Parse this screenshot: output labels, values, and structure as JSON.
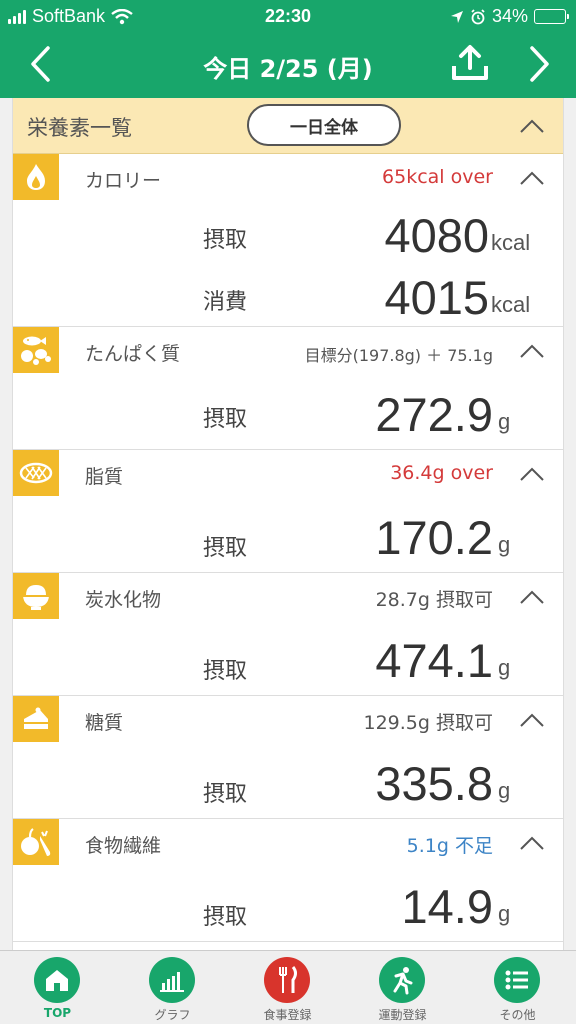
{
  "status_bar": {
    "carrier": "SoftBank",
    "time": "22:30",
    "battery": "34%",
    "battery_level": 0.34
  },
  "header": {
    "title": "今日 2/25 (月)"
  },
  "summary": {
    "label": "栄養素一覧",
    "button": "一日全体"
  },
  "sections": [
    {
      "name": "カロリー",
      "status": "65kcal over",
      "rows": [
        {
          "label": "摂取",
          "value": "4080",
          "unit": "kcal"
        },
        {
          "label": "消費",
          "value": "4015",
          "unit": "kcal"
        }
      ]
    },
    {
      "name": "たんぱく質",
      "status": "目標分(197.8g) ＋ 75.1g",
      "rows": [
        {
          "label": "摂取",
          "value": "272.9",
          "unit": "g"
        }
      ]
    },
    {
      "name": "脂質",
      "status": "36.4g over",
      "rows": [
        {
          "label": "摂取",
          "value": "170.2",
          "unit": "g"
        }
      ]
    },
    {
      "name": "炭水化物",
      "status": "28.7g 摂取可",
      "rows": [
        {
          "label": "摂取",
          "value": "474.1",
          "unit": "g"
        }
      ]
    },
    {
      "name": "糖質",
      "status": "129.5g 摂取可",
      "rows": [
        {
          "label": "摂取",
          "value": "335.8",
          "unit": "g"
        }
      ]
    },
    {
      "name": "食物繊維",
      "status": "5.1g 不足",
      "rows": [
        {
          "label": "摂取",
          "value": "14.9",
          "unit": "g"
        }
      ]
    }
  ],
  "tabs": [
    {
      "label": "TOP",
      "icon": "home-icon"
    },
    {
      "label": "グラフ",
      "icon": "bar-chart-icon"
    },
    {
      "label": "食事登録",
      "icon": "fork-knife-icon"
    },
    {
      "label": "運動登録",
      "icon": "runner-icon"
    },
    {
      "label": "その他",
      "icon": "list-icon"
    }
  ],
  "colors": {
    "brand_green": "#18a66b",
    "badge_yellow": "#f2ba2a",
    "over_red": "#d43a3a",
    "lack_blue": "#3d84c6",
    "summary_bg": "#fbe8b4"
  }
}
